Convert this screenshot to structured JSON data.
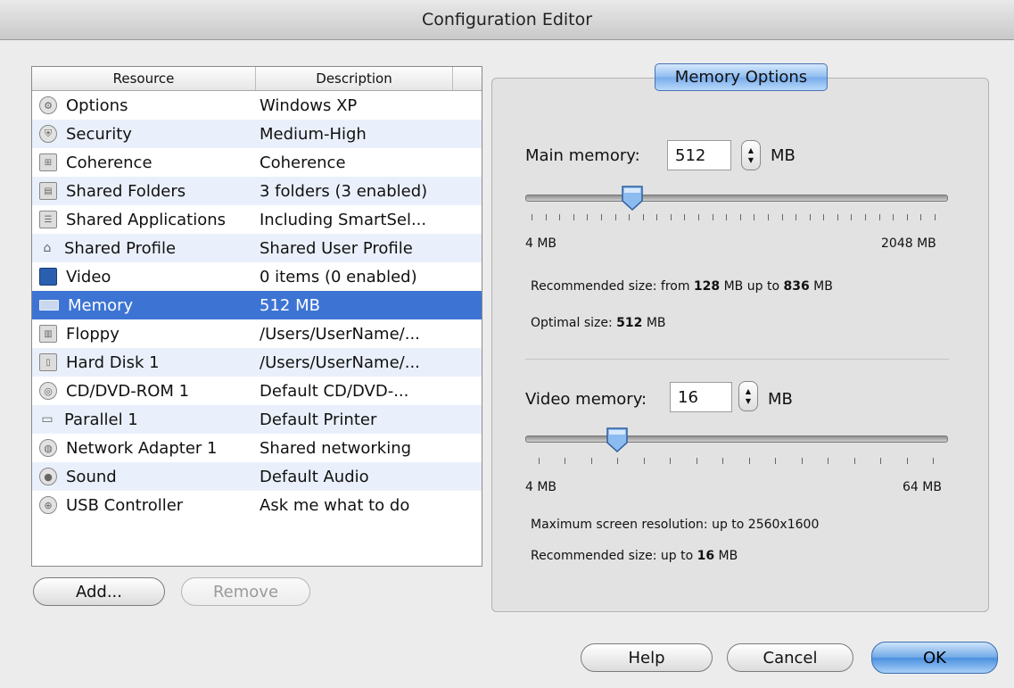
{
  "window": {
    "title": "Configuration Editor"
  },
  "list": {
    "columns": {
      "resource": "Resource",
      "description": "Description"
    },
    "rows": [
      {
        "icon": "gear-icon",
        "resource": "Options",
        "description": "Windows XP"
      },
      {
        "icon": "shield-icon",
        "resource": "Security",
        "description": "Medium-High"
      },
      {
        "icon": "coherence-icon",
        "resource": "Coherence",
        "description": "Coherence"
      },
      {
        "icon": "shared-folder-icon",
        "resource": "Shared Folders",
        "description": "3 folders (3 enabled)"
      },
      {
        "icon": "shared-apps-icon",
        "resource": "Shared Applications",
        "description": "Including SmartSel..."
      },
      {
        "icon": "home-icon",
        "resource": "Shared Profile",
        "description": "Shared User Profile"
      },
      {
        "icon": "monitor-icon",
        "resource": "Video",
        "description": "0 items (0 enabled)"
      },
      {
        "icon": "memory-icon",
        "resource": "Memory",
        "description": "512 MB"
      },
      {
        "icon": "floppy-icon",
        "resource": "Floppy",
        "description": "/Users/UserName/..."
      },
      {
        "icon": "hard-disk-icon",
        "resource": "Hard Disk 1",
        "description": "/Users/UserName/..."
      },
      {
        "icon": "cd-icon",
        "resource": "CD/DVD-ROM 1",
        "description": "Default CD/DVD-..."
      },
      {
        "icon": "printer-icon",
        "resource": "Parallel 1",
        "description": "Default Printer"
      },
      {
        "icon": "network-icon",
        "resource": "Network Adapter 1",
        "description": "Shared networking"
      },
      {
        "icon": "speaker-icon",
        "resource": "Sound",
        "description": "Default Audio"
      },
      {
        "icon": "usb-icon",
        "resource": "USB Controller",
        "description": "Ask me what to do"
      }
    ],
    "selected_index": 7
  },
  "buttons": {
    "add": "Add...",
    "remove": "Remove",
    "help": "Help",
    "cancel": "Cancel",
    "ok": "OK"
  },
  "memory_panel": {
    "tab_label": "Memory Options",
    "main": {
      "label": "Main memory:",
      "value": "512",
      "unit": "MB",
      "min_label": "4 MB",
      "max_label": "2048 MB",
      "slider_fraction": 0.25,
      "recommended_prefix": "Recommended size: from ",
      "recommended_from": "128",
      "recommended_mid": " MB up to ",
      "recommended_to": "836",
      "recommended_suffix": " MB",
      "optimal_prefix": "Optimal size: ",
      "optimal_value": "512",
      "optimal_suffix": " MB"
    },
    "video": {
      "label": "Video memory:",
      "value": "16",
      "unit": "MB",
      "min_label": "4 MB",
      "max_label": "64 MB",
      "slider_fraction": 0.2,
      "max_resolution": "Maximum screen resolution: up to 2560x1600",
      "recommended_prefix": "Recommended size: up to ",
      "recommended_value": "16",
      "recommended_suffix": " MB"
    }
  }
}
